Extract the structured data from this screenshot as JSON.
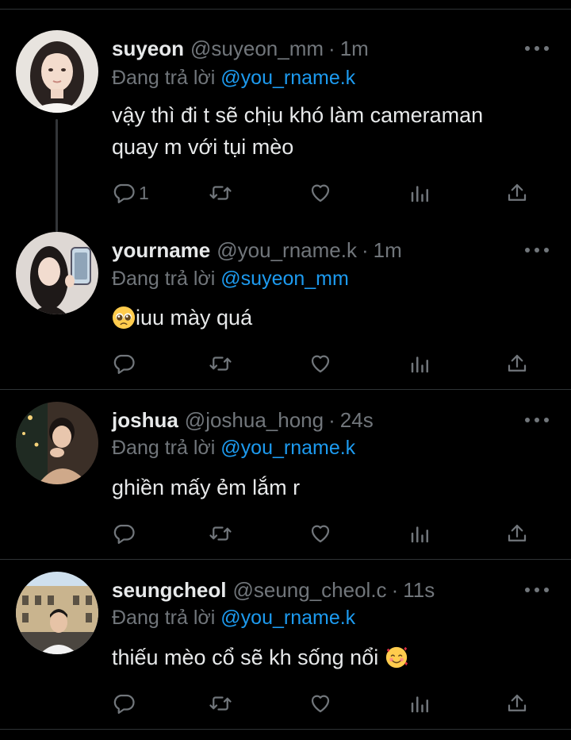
{
  "tweets": [
    {
      "name": "suyeon",
      "handle": "@suyeon_mm",
      "sep": "·",
      "time": "1m",
      "replying_prefix": "Đang trả lời ",
      "replying_to": "@you_rname.k",
      "text_line1": "vậy thì đi t sẽ chịu khó làm cameraman",
      "text_line2": "quay m với tụi mèo",
      "reply_count": "1"
    },
    {
      "name": "yourname",
      "handle": "@you_rname.k",
      "sep": "·",
      "time": "1m",
      "replying_prefix": "Đang trả lời ",
      "replying_to": "@suyeon_mm",
      "emoji": "pleading-face-emoji",
      "text_line1": "iuu mày quá",
      "reply_count": ""
    },
    {
      "name": "joshua",
      "handle": "@joshua_hong",
      "sep": "·",
      "time": "24s",
      "replying_prefix": "Đang trả lời ",
      "replying_to": "@you_rname.k",
      "text_line1": "ghiền mấy ẻm lắm r",
      "reply_count": ""
    },
    {
      "name": "seungcheol",
      "handle": "@seung_cheol.c",
      "sep": "·",
      "time": "11s",
      "replying_prefix": "Đang trả lời ",
      "replying_to": "@you_rname.k",
      "text_line1": "thiếu mèo cổ sẽ kh sống nổi ",
      "emoji": "smiling-face-with-hearts-emoji",
      "reply_count": ""
    }
  ],
  "icons": {
    "reply": "reply-icon",
    "retweet": "retweet-icon",
    "like": "heart-icon",
    "views": "views-icon",
    "share": "share-icon",
    "more": "more-icon"
  },
  "colors": {
    "background": "#000000",
    "text": "#e7e9ea",
    "muted": "#71767b",
    "accent": "#1d9bf0",
    "divider": "#2f3336"
  }
}
